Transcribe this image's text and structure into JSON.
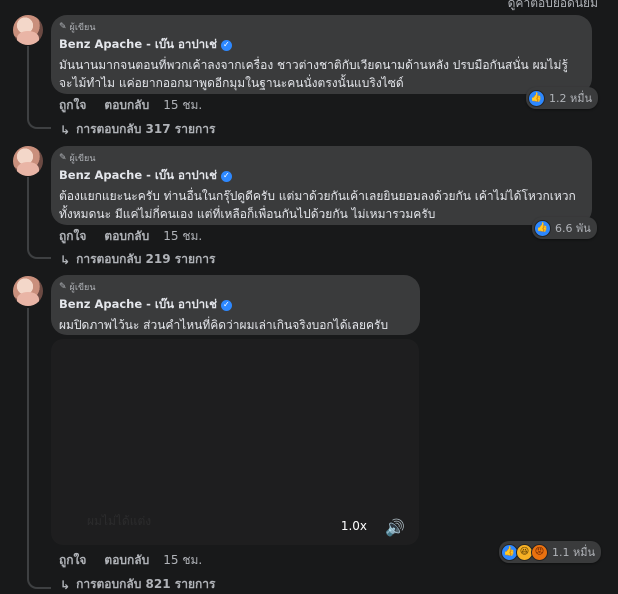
{
  "top_partial_text": "ดูคำตอบยอดนิยม",
  "comments": [
    {
      "badge": "ผู้เขียน",
      "author": "Benz Apache - เบ๊น อาปาเช่",
      "text": "มันนานมากจนตอนที่พวกเค้าลงจากเครื่อง ชาวต่างชาติกับเวียดนามด้านหลัง ปรบมือกันสนั่น ผมไม่รู้จะไม้ทำไม แค่อยากออกมาพูดอีกมุมในฐานะคนนั่งตรงนั้นแบริงไซด์",
      "like_label": "ถูกใจ",
      "reply_label": "ตอบกลับ",
      "time": "15 ชม.",
      "reaction_count": "1.2 หมื่น",
      "replies_label": "การตอบกลับ 317 รายการ"
    },
    {
      "badge": "ผู้เขียน",
      "author": "Benz Apache - เบ๊น อาปาเช่",
      "text": "ต้องแยกแยะนะครับ ท่านอื่นในกรุ๊ปดูดีครับ แต่มาด้วยกันเค้าเลยยินยอมลงด้วยกัน เค้าไม่ได้โหวกเหวกทั้งหมดนะ มีแค่ไม่กี่คนเอง แต่ที่เหลือก็เพื่อนกันไปด้วยกัน ไม่เหมารวมครับ",
      "like_label": "ถูกใจ",
      "reply_label": "ตอบกลับ",
      "time": "15 ชม.",
      "reaction_count": "6.6 พัน",
      "replies_label": "การตอบกลับ 219 รายการ"
    },
    {
      "badge": "ผู้เขียน",
      "author": "Benz Apache - เบ๊น อาปาเช่",
      "text": "ผมปิดภาพไว้นะ ส่วนคำไหนที่คิดว่าผมเล่าเกินจริงบอกได้เลยครับ",
      "like_label": "ถูกใจ",
      "reply_label": "ตอบกลับ",
      "time": "15 ชม.",
      "reaction_count": "1.1 หมื่น",
      "replies_label": "การตอบกลับ 821 รายการ"
    }
  ],
  "video": {
    "faint_text": "ผมไม่ได้แต่ง",
    "speed": "1.0x"
  },
  "colors": {
    "background": "#18191a",
    "bubble": "#3a3b3c",
    "accent": "#2d88ff",
    "muted_text": "#b0b3b8"
  },
  "icons": {
    "pencil": "pencil-icon",
    "verified": "verified-badge-icon",
    "reply_arrow": "reply-arrow-icon",
    "like": "like-reaction-icon",
    "haha": "haha-reaction-icon",
    "angry": "angry-reaction-icon",
    "volume": "volume-icon"
  }
}
